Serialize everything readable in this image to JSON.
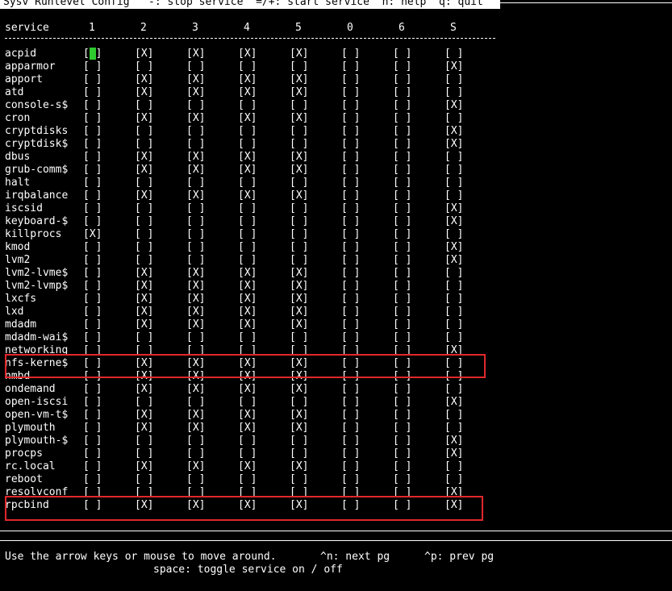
{
  "title": "Sysv Runlevel Config   -: stop service  =/+: start service  h: help  q: quit",
  "columns": [
    "service",
    "1",
    "2",
    "3",
    "4",
    "5",
    "0",
    "6",
    "S"
  ],
  "checkbox": {
    "on": "[X]",
    "off": "[ ]"
  },
  "colors": {
    "background": "#000000",
    "foreground": "#ffffff",
    "cursor": "#2ecc2e",
    "highlight_box": "#e0282c"
  },
  "services": [
    {
      "name": "acpid",
      "levels": [
        0,
        1,
        1,
        1,
        1,
        0,
        0,
        0
      ]
    },
    {
      "name": "apparmor",
      "levels": [
        0,
        0,
        0,
        0,
        0,
        0,
        0,
        1
      ]
    },
    {
      "name": "apport",
      "levels": [
        0,
        1,
        1,
        1,
        1,
        0,
        0,
        0
      ]
    },
    {
      "name": "atd",
      "levels": [
        0,
        1,
        1,
        1,
        1,
        0,
        0,
        0
      ]
    },
    {
      "name": "console-s$",
      "levels": [
        0,
        0,
        0,
        0,
        0,
        0,
        0,
        1
      ]
    },
    {
      "name": "cron",
      "levels": [
        0,
        1,
        1,
        1,
        1,
        0,
        0,
        0
      ]
    },
    {
      "name": "cryptdisks",
      "levels": [
        0,
        0,
        0,
        0,
        0,
        0,
        0,
        1
      ]
    },
    {
      "name": "cryptdisk$",
      "levels": [
        0,
        0,
        0,
        0,
        0,
        0,
        0,
        1
      ]
    },
    {
      "name": "dbus",
      "levels": [
        0,
        1,
        1,
        1,
        1,
        0,
        0,
        0
      ]
    },
    {
      "name": "grub-comm$",
      "levels": [
        0,
        1,
        1,
        1,
        1,
        0,
        0,
        0
      ]
    },
    {
      "name": "halt",
      "levels": [
        0,
        0,
        0,
        0,
        0,
        0,
        0,
        0
      ]
    },
    {
      "name": "irqbalance",
      "levels": [
        0,
        1,
        1,
        1,
        1,
        0,
        0,
        0
      ]
    },
    {
      "name": "iscsid",
      "levels": [
        0,
        0,
        0,
        0,
        0,
        0,
        0,
        1
      ]
    },
    {
      "name": "keyboard-$",
      "levels": [
        0,
        0,
        0,
        0,
        0,
        0,
        0,
        1
      ]
    },
    {
      "name": "killprocs",
      "levels": [
        1,
        0,
        0,
        0,
        0,
        0,
        0,
        0
      ]
    },
    {
      "name": "kmod",
      "levels": [
        0,
        0,
        0,
        0,
        0,
        0,
        0,
        1
      ]
    },
    {
      "name": "lvm2",
      "levels": [
        0,
        0,
        0,
        0,
        0,
        0,
        0,
        1
      ]
    },
    {
      "name": "lvm2-lvme$",
      "levels": [
        0,
        1,
        1,
        1,
        1,
        0,
        0,
        0
      ]
    },
    {
      "name": "lvm2-lvmp$",
      "levels": [
        0,
        1,
        1,
        1,
        1,
        0,
        0,
        0
      ]
    },
    {
      "name": "lxcfs",
      "levels": [
        0,
        1,
        1,
        1,
        1,
        0,
        0,
        0
      ]
    },
    {
      "name": "lxd",
      "levels": [
        0,
        1,
        1,
        1,
        1,
        0,
        0,
        0
      ]
    },
    {
      "name": "mdadm",
      "levels": [
        0,
        1,
        1,
        1,
        1,
        0,
        0,
        0
      ]
    },
    {
      "name": "mdadm-wai$",
      "levels": [
        0,
        0,
        0,
        0,
        0,
        0,
        0,
        0
      ]
    },
    {
      "name": "networking",
      "levels": [
        0,
        0,
        0,
        0,
        0,
        0,
        0,
        1
      ]
    },
    {
      "name": "nfs-kerne$",
      "levels": [
        0,
        1,
        1,
        1,
        1,
        0,
        0,
        0
      ]
    },
    {
      "name": "nmbd",
      "levels": [
        0,
        1,
        1,
        1,
        1,
        0,
        0,
        0
      ]
    },
    {
      "name": "ondemand",
      "levels": [
        0,
        1,
        1,
        1,
        1,
        0,
        0,
        0
      ]
    },
    {
      "name": "open-iscsi",
      "levels": [
        0,
        0,
        0,
        0,
        0,
        0,
        0,
        1
      ]
    },
    {
      "name": "open-vm-t$",
      "levels": [
        0,
        1,
        1,
        1,
        1,
        0,
        0,
        0
      ]
    },
    {
      "name": "plymouth",
      "levels": [
        0,
        1,
        1,
        1,
        1,
        0,
        0,
        0
      ]
    },
    {
      "name": "plymouth-$",
      "levels": [
        0,
        0,
        0,
        0,
        0,
        0,
        0,
        1
      ]
    },
    {
      "name": "procps",
      "levels": [
        0,
        0,
        0,
        0,
        0,
        0,
        0,
        1
      ]
    },
    {
      "name": "rc.local",
      "levels": [
        0,
        1,
        1,
        1,
        1,
        0,
        0,
        0
      ]
    },
    {
      "name": "reboot",
      "levels": [
        0,
        0,
        0,
        0,
        0,
        0,
        0,
        0
      ]
    },
    {
      "name": "resolvconf",
      "levels": [
        0,
        0,
        0,
        0,
        0,
        0,
        0,
        1
      ]
    },
    {
      "name": "rpcbind",
      "levels": [
        0,
        1,
        1,
        1,
        1,
        0,
        0,
        1
      ]
    }
  ],
  "cursor": {
    "service": "acpid",
    "column": "1"
  },
  "highlighted_services": [
    "nfs-kerne$",
    "rpcbind"
  ],
  "footer": {
    "line1_left": "Use the arrow keys or mouse to move around.",
    "next_page": "^n: next pg",
    "prev_page": "^p: prev pg",
    "line2": "space: toggle service on / off"
  }
}
